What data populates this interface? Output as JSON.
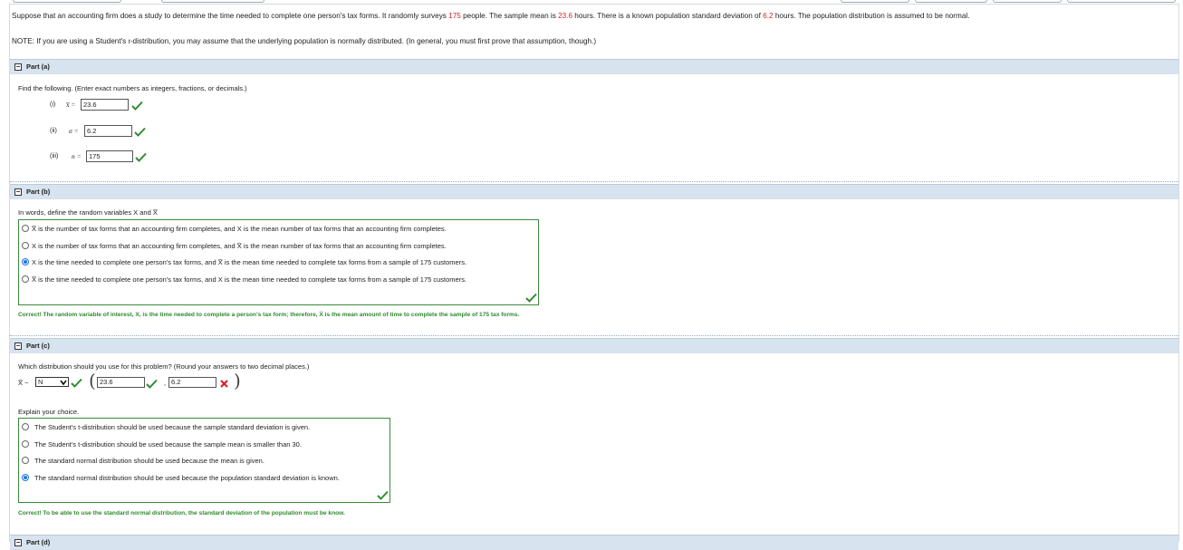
{
  "problem": {
    "pre1": "Suppose that an accounting firm does a study to determine the time needed to complete one person's tax forms. It randomly surveys ",
    "n": "175",
    "pre2": " people. The sample mean is ",
    "mean": "23.6",
    "pre3": " hours. There is a known population standard deviation of ",
    "sd": "6.2",
    "pre4": " hours. The population distribution is assumed to be normal."
  },
  "note": {
    "pre": "NOTE: If you are using a Student's ",
    "t": "t",
    "post": "-distribution, you may assume that the underlying population is normally distributed. (In general, you must first prove that assumption, though.)"
  },
  "part_a": {
    "title": "Part (a)",
    "instruction": "Find the following. (Enter exact numbers as integers, fractions, or decimals.)",
    "items": [
      {
        "num": "(i)",
        "sym": "x̅ =",
        "value": "23.6"
      },
      {
        "num": "(ii)",
        "sym": "σ =",
        "value": "6.2"
      },
      {
        "num": "(iii)",
        "sym": "n =",
        "value": "175"
      }
    ]
  },
  "part_b": {
    "title": "Part (b)",
    "question": "In words, define the random variables X and X̅",
    "choices": [
      {
        "a": "X̅",
        "b": " is the number of tax forms that an accounting firm completes, and ",
        "c": "X",
        "d": " is the mean number of tax forms that an accounting firm completes.",
        "selected": false
      },
      {
        "a": "X",
        "b": " is the number of tax forms that an accounting firm completes, and ",
        "c": "X̅",
        "d": " is the mean number of tax forms that an accounting firm completes.",
        "selected": false
      },
      {
        "a": "X",
        "b": " is the time needed to complete one person's tax forms, and ",
        "c": "X̅",
        "d": " is the mean time needed to complete tax forms from a sample of 175 customers.",
        "selected": true
      },
      {
        "a": "X̅",
        "b": " is the time needed to complete one person's tax forms, and ",
        "c": "X",
        "d": " is the mean time needed to complete tax forms from a sample of 175 customers.",
        "selected": false
      }
    ],
    "feedback": "Correct! The random variable of interest, X, is the time needed to complete a person's tax form; therefore, X̅ is the mean amount of time to complete the sample of 175 tax forms."
  },
  "part_c": {
    "title": "Part (c)",
    "question": "Which distribution should you use for this problem? (Round your answers to two decimal places.)",
    "dist_prefix": "X̅ ~",
    "dist_value": "N",
    "param1": "23.6",
    "param2": "6.2",
    "explain_label": "Explain your choice.",
    "choices": [
      {
        "label": "The Student's t-distribution should be used because the sample standard deviation is given.",
        "selected": false
      },
      {
        "label": "The Student's t-distribution should be used because the sample mean is smaller than 30.",
        "selected": false
      },
      {
        "label": "The standard normal distribution should be used because the mean is given.",
        "selected": false
      },
      {
        "label": "The standard normal distribution should be used because the population standard deviation is known.",
        "selected": true
      }
    ],
    "feedback": "Correct! To be able to use the standard normal distribution, the standard deviation of the population must be know."
  },
  "part_d": {
    "title": "Part (d)"
  },
  "colors": {
    "correct": "#2e8b2e",
    "wrong": "#d2232a",
    "header": "#d7e3ee",
    "radio": "#1a73e8"
  }
}
